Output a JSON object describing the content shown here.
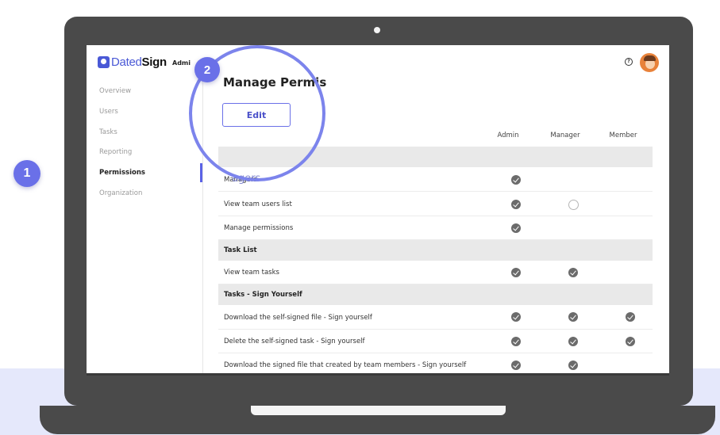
{
  "steps": {
    "step1": "1",
    "step2": "2"
  },
  "app": {
    "logo_part1": "Dated",
    "logo_part2": "Sign",
    "admin_label": "Admi"
  },
  "header": {
    "help_icon": "?"
  },
  "sidebar": {
    "items": [
      {
        "label": "Overview"
      },
      {
        "label": "Users"
      },
      {
        "label": "Tasks"
      },
      {
        "label": "Reporting"
      },
      {
        "label": "Permissions",
        "active": true
      },
      {
        "label": "Organization"
      }
    ]
  },
  "page": {
    "title": "Manage Permis",
    "edit_label": "Edit"
  },
  "columns": [
    "Admin",
    "Manager",
    "Member"
  ],
  "magnifier_ghost_text": "agers",
  "rows": [
    {
      "type": "section",
      "label": ""
    },
    {
      "type": "item",
      "label": "Managers",
      "admin": true,
      "manager": false,
      "member": false
    },
    {
      "type": "item",
      "label": "View team users list",
      "admin": true,
      "manager": "empty",
      "member": false
    },
    {
      "type": "item",
      "label": "Manage permissions",
      "admin": true,
      "manager": false,
      "member": false
    },
    {
      "type": "section",
      "label": "Task List"
    },
    {
      "type": "item",
      "label": "View team tasks",
      "admin": true,
      "manager": true,
      "member": false
    },
    {
      "type": "section",
      "label": "Tasks - Sign Yourself"
    },
    {
      "type": "item",
      "label": "Download the self-signed file - Sign yourself",
      "admin": true,
      "manager": true,
      "member": true
    },
    {
      "type": "item",
      "label": "Delete the self-signed task - Sign yourself",
      "admin": true,
      "manager": true,
      "member": true
    },
    {
      "type": "item",
      "label": "Download the signed file that created by team members - Sign yourself",
      "admin": true,
      "manager": true,
      "member": false
    }
  ],
  "colors": {
    "accent": "#6a70e8",
    "brand": "#4a59d6",
    "check": "#6b6b6b",
    "band": "#e5e8fb"
  }
}
